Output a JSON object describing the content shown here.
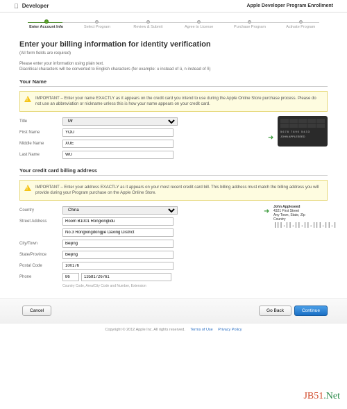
{
  "topbar": {
    "brand": "Developer",
    "program": "Apple Developer Program Enrollment"
  },
  "steps": [
    "Enter Account Info",
    "Select Program",
    "Review & Submit",
    "Agree to License",
    "Purchase Program",
    "Activate Program"
  ],
  "heading": "Enter your billing information for identity verification",
  "required": "(All form fields are required)",
  "hint1": "Please enter your information using plain text.",
  "hint2": "Diacritical characters will be converted to English characters (for example: u instead of ü, n instead of ñ)",
  "section_name": "Your Name",
  "alert_name": "IMPORTANT – Enter your name EXACTLY as it appears on the credit card you intend to use during the Apple Online Store purchase process. Please do not use an abbreviation or nickname unless this is how your name appears on your credit card.",
  "labels": {
    "title": "Title",
    "first": "First Name",
    "middle": "Middle Name",
    "last": "Last Name",
    "country": "Country",
    "street": "Street Address",
    "city": "City/Town",
    "state": "State/Province",
    "postal": "Postal Code",
    "phone": "Phone"
  },
  "values": {
    "title": "Mr",
    "first": "YOU",
    "middle": "XUE",
    "last": "WU",
    "country": "China",
    "street1": "Room B1001 Rongxinglidu",
    "street2": "No.3 Rongxingdongjie Daxing District",
    "city": "Beijing",
    "state": "Beijing",
    "postal": "100176",
    "phonecc": "86",
    "phone": "13581726761"
  },
  "phone_hint": "Country Code, Area/City Code and Number, Extension",
  "card": {
    "num": "5678 7890 5433",
    "name": "JOHN APPLESEED"
  },
  "section_addr": "Your credit card billing address",
  "alert_addr": "IMPORTANT – Enter your address EXACTLY as it appears on your most recent credit card bill. This billing address must match the billing address you will provide during your Program purchase on the Apple Online Store.",
  "envelope": {
    "name": "John Appleseed",
    "l1": "4321 First Street",
    "l2": "Any Town, State, Zip",
    "l3": "Country",
    "barcode": "|||.||.||.||.|||.||.|"
  },
  "buttons": {
    "cancel": "Cancel",
    "back": "Go Back",
    "cont": "Continue"
  },
  "footer": {
    "copy": "Copyright © 2012 Apple Inc. All rights reserved.",
    "terms": "Terms of Use",
    "privacy": "Privacy Policy"
  },
  "watermark": {
    "a": "JB51",
    "b": ".Net"
  }
}
